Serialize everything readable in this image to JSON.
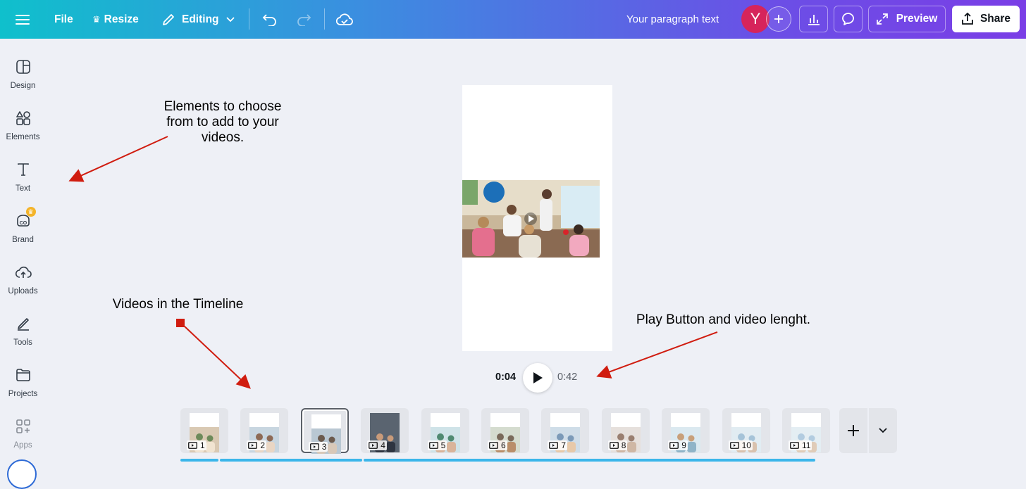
{
  "topbar": {
    "file": "File",
    "resize": "Resize",
    "mode": "Editing",
    "doc_title": "Your paragraph text",
    "avatar_initial": "Y",
    "preview": "Preview",
    "share": "Share"
  },
  "sidebar": {
    "items": [
      {
        "label": "Design",
        "icon": "design-icon"
      },
      {
        "label": "Elements",
        "icon": "elements-icon"
      },
      {
        "label": "Text",
        "icon": "text-icon"
      },
      {
        "label": "Brand",
        "icon": "brand-icon"
      },
      {
        "label": "Uploads",
        "icon": "uploads-icon"
      },
      {
        "label": "Tools",
        "icon": "tools-icon"
      },
      {
        "label": "Projects",
        "icon": "projects-icon"
      },
      {
        "label": "Apps",
        "icon": "apps-icon"
      }
    ]
  },
  "annotations": {
    "elements": "Elements to choose from to add to your videos.",
    "timeline": "Videos in the Timeline",
    "playback": "Play Button and video lenght."
  },
  "playback": {
    "current": "0:04",
    "total": "0:42"
  },
  "timeline": {
    "clips": [
      "1",
      "2",
      "3",
      "4",
      "5",
      "6",
      "7",
      "8",
      "9",
      "10",
      "11"
    ],
    "selected": "3"
  },
  "colors": {
    "accent": "#7a3ee6",
    "avatar": "#d6245b",
    "arrow": "#d01c0f",
    "progress": "#3bb6ea"
  }
}
